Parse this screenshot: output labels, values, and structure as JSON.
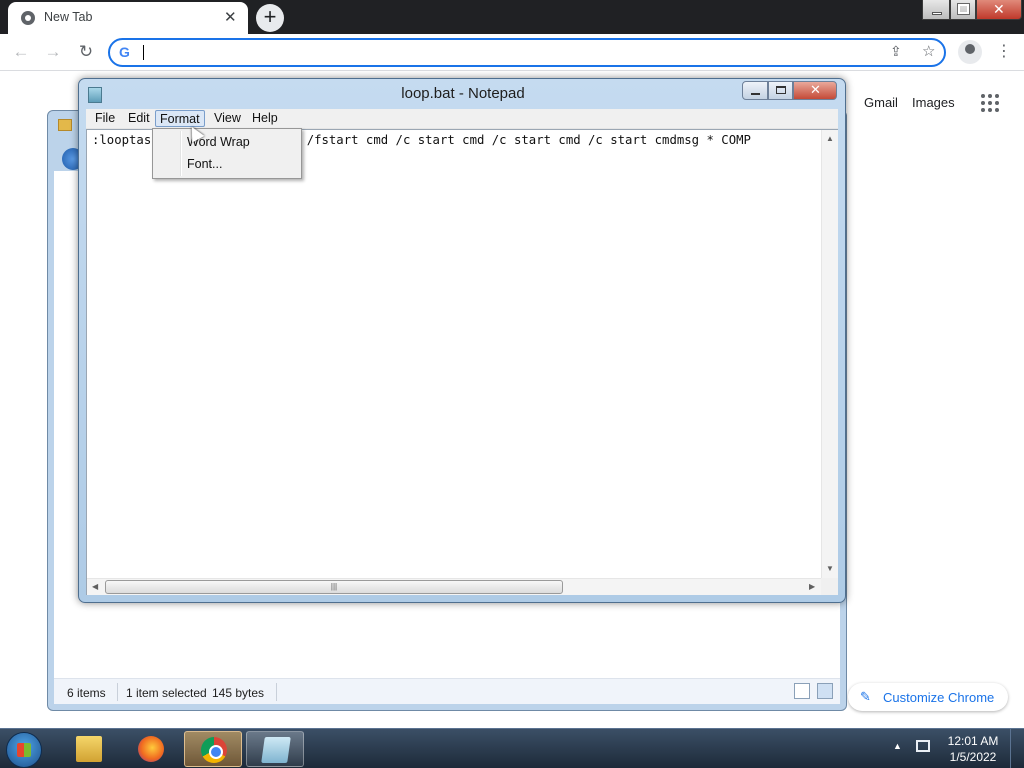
{
  "browser": {
    "tab_title": "New Tab",
    "tab_close": "✕",
    "new_tab": "+",
    "omnibox_value": "",
    "gmail": "Gmail",
    "images": "Images",
    "customize": "Customize Chrome",
    "icons": [
      "chrome-favicon-icon",
      "back-arrow-icon",
      "forward-arrow-icon",
      "reload-icon",
      "google-g-icon",
      "share-icon",
      "star-icon",
      "profile-icon",
      "menu-dots-icon",
      "apps-grid-icon",
      "pencil-icon"
    ]
  },
  "explorer": {
    "item_count": "6 items",
    "selection": "1 item selected",
    "size": "145 bytes"
  },
  "notepad": {
    "title": "loop.bat - Notepad",
    "menu": {
      "file": "File",
      "edit": "Edit",
      "format": "Format",
      "view": "View",
      "help": "Help"
    },
    "format_menu": {
      "word_wrap": "Word Wrap",
      "font": "Font..."
    },
    "text_line": ":looptas                 exe /fstart cmd /c start cmd /c start cmd /c start cmdmsg * COMP"
  },
  "taskbar": {
    "time": "12:01 AM",
    "date": "1/5/2022",
    "pinned": [
      "windows-explorer",
      "firefox",
      "chrome",
      "notepad"
    ]
  },
  "colors": {
    "omnibox_border": "#1a73e8",
    "chrome_frame": "#202124",
    "taskbar": "#1d2a39"
  }
}
